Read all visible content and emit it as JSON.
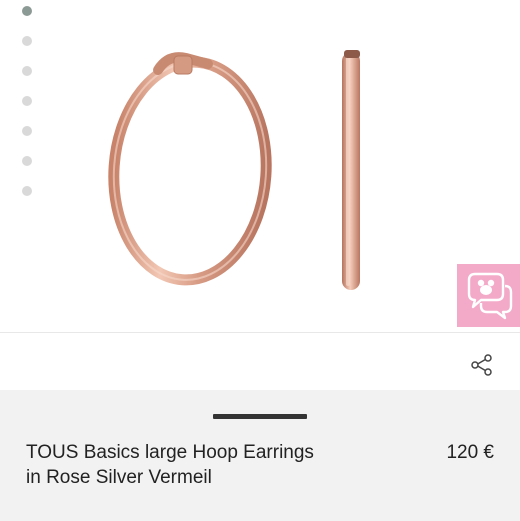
{
  "gallery": {
    "image_count": 7,
    "active_index": 0,
    "image_alt": "TOUS Basics large Hoop Earrings in Rose Silver Vermeil",
    "metal_color": "#d7a088",
    "indicator_active_color": "#8c9a95",
    "indicator_inactive_color": "#d9d9d9"
  },
  "chat": {
    "icon": "chat-bubbles-icon",
    "color": "#f3aac8"
  },
  "share": {
    "icon": "share-icon"
  },
  "product": {
    "name": "TOUS Basics large Hoop Earrings in Rose Silver Vermeil",
    "price": "120 €"
  }
}
